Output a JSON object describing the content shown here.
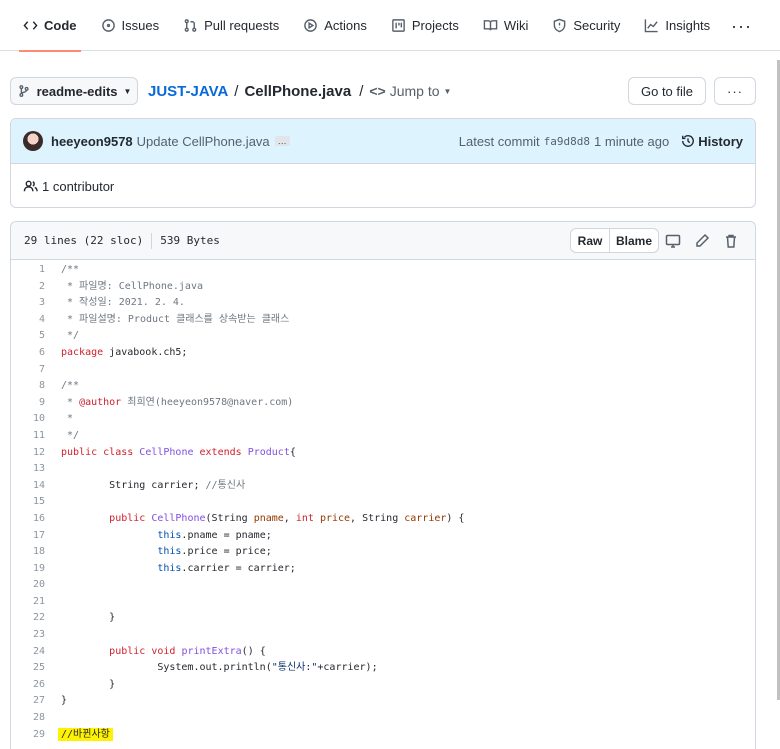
{
  "tabs": [
    {
      "label": "Code",
      "icon": "code-icon",
      "active": true
    },
    {
      "label": "Issues",
      "icon": "issue-icon"
    },
    {
      "label": "Pull requests",
      "icon": "pull-request-icon"
    },
    {
      "label": "Actions",
      "icon": "play-icon"
    },
    {
      "label": "Projects",
      "icon": "project-icon"
    },
    {
      "label": "Wiki",
      "icon": "book-icon"
    },
    {
      "label": "Security",
      "icon": "shield-icon"
    },
    {
      "label": "Insights",
      "icon": "graph-icon"
    }
  ],
  "more_label": "···",
  "branch": "readme-edits",
  "repo": "JUST-JAVA",
  "sep": "/",
  "file": "CellPhone.java",
  "jump": "Jump to",
  "go_to_file": "Go to file",
  "dots": "···",
  "commit": {
    "author": "heeyeon9578",
    "message": "Update CellPhone.java",
    "ellipsis": "…",
    "latest": "Latest commit",
    "sha": "fa9d8d8",
    "time": "1 minute ago",
    "history": "History"
  },
  "contributors": "1 contributor",
  "file_info": {
    "lines": "29 lines (22 sloc)",
    "size": "539 Bytes",
    "raw": "Raw",
    "blame": "Blame"
  },
  "code_lines": [
    [
      {
        "t": "/**",
        "c": "c"
      }
    ],
    [
      {
        "t": " * 파일명: CellPhone.java",
        "c": "c"
      }
    ],
    [
      {
        "t": " * 작성일: 2021. 2. 4.",
        "c": "c"
      }
    ],
    [
      {
        "t": " * 파일설명: Product 클래스를 상속받는 클래스",
        "c": "c"
      }
    ],
    [
      {
        "t": " */",
        "c": "c"
      }
    ],
    [
      {
        "t": "package",
        "c": "k"
      },
      {
        "t": " javabook.ch5;",
        "c": ""
      }
    ],
    [],
    [
      {
        "t": "/**",
        "c": "c"
      }
    ],
    [
      {
        "t": " * ",
        "c": "c"
      },
      {
        "t": "@author",
        "c": "k"
      },
      {
        "t": " 최희연(heeyeon9578@naver.com)",
        "c": "c"
      }
    ],
    [
      {
        "t": " *",
        "c": "c"
      }
    ],
    [
      {
        "t": " */",
        "c": "c"
      }
    ],
    [
      {
        "t": "public",
        "c": "k"
      },
      {
        "t": " ",
        "c": ""
      },
      {
        "t": "class",
        "c": "k"
      },
      {
        "t": " ",
        "c": ""
      },
      {
        "t": "CellPhone",
        "c": "e"
      },
      {
        "t": " ",
        "c": ""
      },
      {
        "t": "extends",
        "c": "k"
      },
      {
        "t": " ",
        "c": ""
      },
      {
        "t": "Product",
        "c": "e"
      },
      {
        "t": "{",
        "c": ""
      }
    ],
    [],
    [
      {
        "t": "        String carrier; ",
        "c": ""
      },
      {
        "t": "//통신사",
        "c": "c"
      }
    ],
    [],
    [
      {
        "t": "        ",
        "c": ""
      },
      {
        "t": "public",
        "c": "k"
      },
      {
        "t": " ",
        "c": ""
      },
      {
        "t": "CellPhone",
        "c": "e"
      },
      {
        "t": "(String ",
        "c": ""
      },
      {
        "t": "pname",
        "c": "v"
      },
      {
        "t": ", ",
        "c": ""
      },
      {
        "t": "int",
        "c": "k"
      },
      {
        "t": " ",
        "c": ""
      },
      {
        "t": "price",
        "c": "v"
      },
      {
        "t": ", String ",
        "c": ""
      },
      {
        "t": "carrier",
        "c": "v"
      },
      {
        "t": ") {",
        "c": ""
      }
    ],
    [
      {
        "t": "                ",
        "c": ""
      },
      {
        "t": "this",
        "c": "b"
      },
      {
        "t": ".pname = pname;",
        "c": ""
      }
    ],
    [
      {
        "t": "                ",
        "c": ""
      },
      {
        "t": "this",
        "c": "b"
      },
      {
        "t": ".price = price;",
        "c": ""
      }
    ],
    [
      {
        "t": "                ",
        "c": ""
      },
      {
        "t": "this",
        "c": "b"
      },
      {
        "t": ".carrier = carrier;",
        "c": ""
      }
    ],
    [],
    [],
    [
      {
        "t": "        }",
        "c": ""
      }
    ],
    [],
    [
      {
        "t": "        ",
        "c": ""
      },
      {
        "t": "public",
        "c": "k"
      },
      {
        "t": " ",
        "c": ""
      },
      {
        "t": "void",
        "c": "k"
      },
      {
        "t": " ",
        "c": ""
      },
      {
        "t": "printExtra",
        "c": "e"
      },
      {
        "t": "() {",
        "c": ""
      }
    ],
    [
      {
        "t": "                System.out.println(",
        "c": ""
      },
      {
        "t": "\"통신사:\"",
        "c": "s"
      },
      {
        "t": "+carrier);",
        "c": ""
      }
    ],
    [
      {
        "t": "        }",
        "c": ""
      }
    ],
    [
      {
        "t": "}",
        "c": ""
      }
    ],
    [],
    [
      {
        "t": "//바뀐사항",
        "c": "hl"
      }
    ]
  ]
}
